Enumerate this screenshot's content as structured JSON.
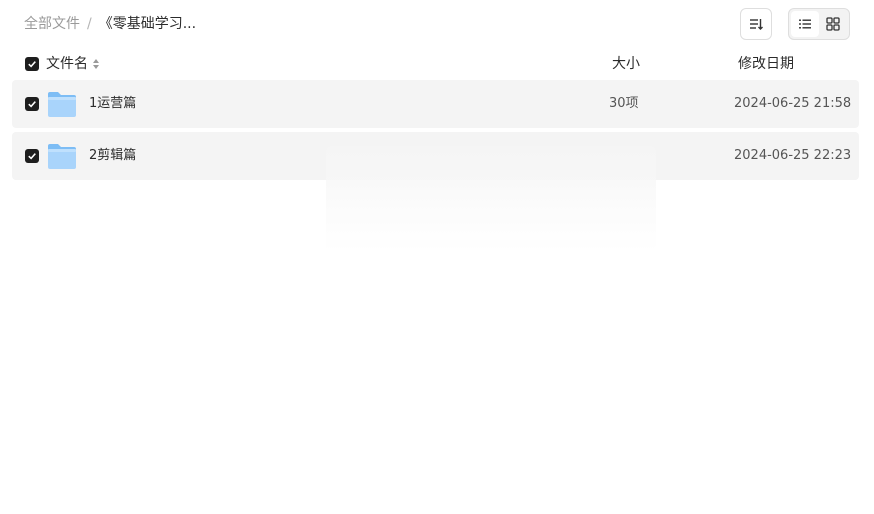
{
  "breadcrumb": {
    "root": "全部文件",
    "separator": "/",
    "current": "《零基础学习..."
  },
  "toolbar": {
    "sort_icon": "sort-lines-icon",
    "view_list_icon": "list-view-icon",
    "view_grid_icon": "grid-view-icon",
    "active_view": "list"
  },
  "columns": {
    "name": "文件名",
    "size": "大小",
    "date": "修改日期"
  },
  "select_all_checked": true,
  "files": [
    {
      "name": "1运营篇",
      "size": "30项",
      "date": "2024-06-25 21:58",
      "type": "folder",
      "checked": true
    },
    {
      "name": "2剪辑篇",
      "size": "",
      "date": "2024-06-25 22:23",
      "type": "folder",
      "checked": true
    }
  ],
  "colors": {
    "checkbox": "#1e1e1e",
    "row_bg": "#f4f4f4",
    "folder_light": "#a9d4fb",
    "folder_dark": "#7dbdf5"
  }
}
